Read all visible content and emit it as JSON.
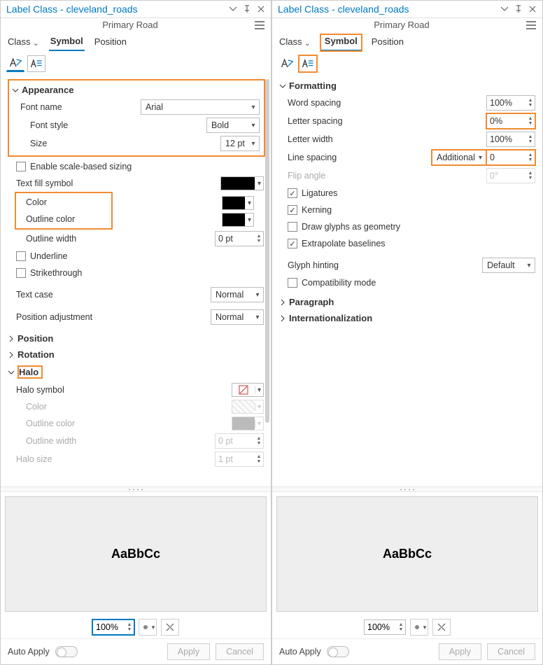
{
  "left": {
    "title": "Label Class - cleveland_roads",
    "subtitle": "Primary Road",
    "tabs": {
      "class": "Class",
      "symbol": "Symbol",
      "position": "Position"
    },
    "sections": {
      "appearance": "Appearance",
      "position": "Position",
      "rotation": "Rotation",
      "halo": "Halo"
    },
    "labels": {
      "font_name": "Font name",
      "font_style": "Font style",
      "size": "Size",
      "enable_scale": "Enable scale-based sizing",
      "text_fill": "Text fill symbol",
      "color": "Color",
      "outline_color": "Outline color",
      "outline_width": "Outline width",
      "underline": "Underline",
      "strike": "Strikethrough",
      "text_case": "Text case",
      "pos_adj": "Position adjustment",
      "halo_symbol": "Halo symbol",
      "halo_color": "Color",
      "halo_outline_color": "Outline color",
      "halo_outline_width": "Outline width",
      "halo_size": "Halo size"
    },
    "values": {
      "font_name": "Arial",
      "font_style": "Bold",
      "size": "12 pt",
      "outline_width": "0 pt",
      "text_case": "Normal",
      "pos_adj": "Normal",
      "halo_outline_width": "0 pt",
      "halo_size": "1 pt"
    },
    "preview": "AaBbCc",
    "zoom": "100%",
    "auto_apply": "Auto Apply",
    "apply": "Apply",
    "cancel": "Cancel"
  },
  "right": {
    "title": "Label Class - cleveland_roads",
    "subtitle": "Primary Road",
    "tabs": {
      "class": "Class",
      "symbol": "Symbol",
      "position": "Position"
    },
    "sections": {
      "formatting": "Formatting",
      "paragraph": "Paragraph",
      "intl": "Internationalization"
    },
    "labels": {
      "word_spacing": "Word spacing",
      "letter_spacing": "Letter spacing",
      "letter_width": "Letter width",
      "line_spacing": "Line spacing",
      "flip_angle": "Flip angle",
      "ligatures": "Ligatures",
      "kerning": "Kerning",
      "glyphs_geom": "Draw glyphs as geometry",
      "extrapolate": "Extrapolate baselines",
      "glyph_hinting": "Glyph hinting",
      "compat": "Compatibility mode"
    },
    "values": {
      "word_spacing": "100%",
      "letter_spacing": "0%",
      "letter_width": "100%",
      "line_spacing_mode": "Additional",
      "line_spacing_val": "0",
      "flip_angle": "0°",
      "glyph_hinting": "Default"
    },
    "preview": "AaBbCc",
    "zoom": "100%",
    "auto_apply": "Auto Apply",
    "apply": "Apply",
    "cancel": "Cancel"
  }
}
